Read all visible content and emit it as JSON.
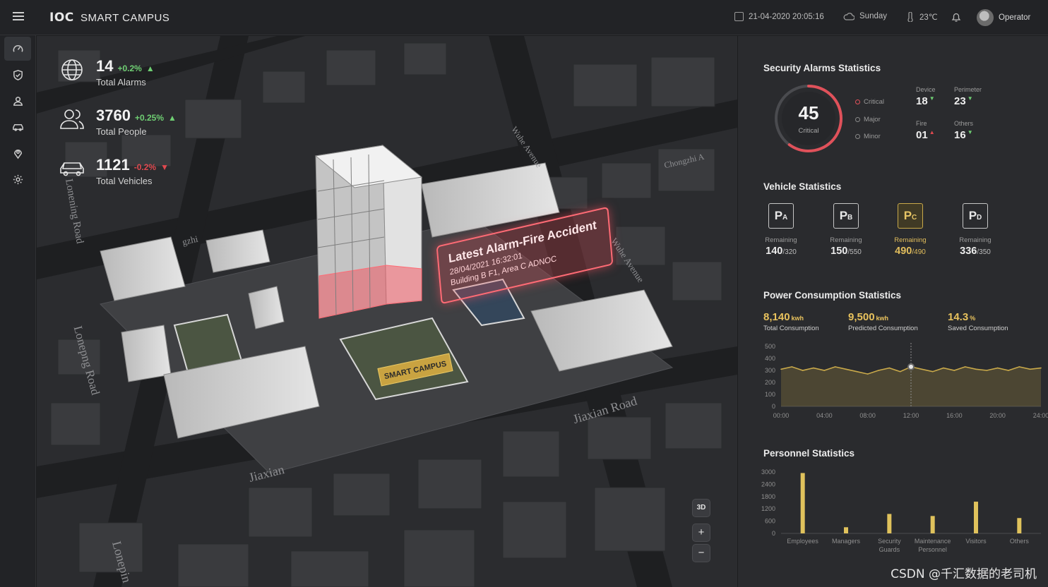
{
  "header": {
    "brand": "IOC",
    "app_name": "SMART CAMPUS",
    "datetime": "21-04-2020 20:05:16",
    "weather": "Sunday",
    "temperature": "23℃",
    "user": "Operator"
  },
  "nav": [
    {
      "icon": "dashboard-icon"
    },
    {
      "icon": "shield-icon"
    },
    {
      "icon": "people-icon"
    },
    {
      "icon": "car-icon"
    },
    {
      "icon": "map-pin-icon"
    },
    {
      "icon": "gear-icon"
    }
  ],
  "map": {
    "stats": [
      {
        "value": "14",
        "change": "+0.2%",
        "trend": "up",
        "label": "Total Alarms",
        "icon": "globe-icon"
      },
      {
        "value": "3760",
        "change": "+0.25%",
        "trend": "up",
        "label": "Total People",
        "icon": "people-icon"
      },
      {
        "value": "1121",
        "change": "-0.2%",
        "trend": "down",
        "label": "Total Vehicles",
        "icon": "car-icon"
      }
    ],
    "alarm": {
      "title": "Latest Alarm-Fire Accident",
      "time": "28/04/2021 16:32:01",
      "location": "Building B F1, Area C ADNOC"
    },
    "campus_sign": "SMART CAMPUS",
    "roads": [
      "Lonening Road",
      "Lonepng Road",
      "Lonepin",
      "Jiaxian Road",
      "Jiaxian",
      "Wuhe Avenue",
      "Wuhe Avenue",
      "Chongzhi A",
      "gzhi"
    ],
    "controls": {
      "view_3d": "3D",
      "zoom_in": "+",
      "zoom_out": "−"
    }
  },
  "security": {
    "title": "Security Alarms Statistics",
    "critical_count": "45",
    "critical_label": "Critical",
    "legend": [
      "Critical",
      "Major",
      "Minor"
    ],
    "items": [
      {
        "label": "Device",
        "value": "18",
        "trend": "down"
      },
      {
        "label": "Perimeter",
        "value": "23",
        "trend": "down"
      },
      {
        "label": "Fire",
        "value": "01",
        "trend": "up"
      },
      {
        "label": "Others",
        "value": "16",
        "trend": "down"
      }
    ],
    "ring_fraction": 0.6
  },
  "vehicles": {
    "title": "Vehicle Statistics",
    "lots": [
      {
        "letter": "P",
        "sub": "A",
        "label": "Remaining",
        "remaining": "140",
        "total": "/320",
        "highlight": false
      },
      {
        "letter": "P",
        "sub": "B",
        "label": "Remaining",
        "remaining": "150",
        "total": "/550",
        "highlight": false
      },
      {
        "letter": "P",
        "sub": "C",
        "label": "Remaining",
        "remaining": "490",
        "total": "/490",
        "highlight": true
      },
      {
        "letter": "P",
        "sub": "D",
        "label": "Remaining",
        "remaining": "336",
        "total": "/350",
        "highlight": false
      }
    ]
  },
  "power": {
    "title": "Power Consumption Statistics",
    "kpis": [
      {
        "value": "8,140",
        "unit": "kwh",
        "label": "Total Consumption"
      },
      {
        "value": "9,500",
        "unit": "kwh",
        "label": "Predicted Consumption"
      },
      {
        "value": "14.3",
        "unit": "%",
        "label": "Saved Consumption"
      }
    ]
  },
  "personnel": {
    "title": "Personnel Statistics"
  },
  "chart_data": [
    {
      "type": "area",
      "x": [
        "00:00",
        "01:00",
        "02:00",
        "03:00",
        "04:00",
        "05:00",
        "06:00",
        "07:00",
        "08:00",
        "09:00",
        "10:00",
        "11:00",
        "12:00",
        "13:00",
        "14:00",
        "15:00",
        "16:00",
        "17:00",
        "18:00",
        "19:00",
        "20:00",
        "21:00",
        "22:00",
        "23:00",
        "24:00"
      ],
      "values": [
        310,
        330,
        300,
        320,
        300,
        330,
        310,
        290,
        270,
        300,
        320,
        290,
        330,
        310,
        290,
        320,
        300,
        330,
        310,
        300,
        320,
        300,
        330,
        310,
        320
      ],
      "xticks": [
        "00:00",
        "04:00",
        "08:00",
        "12:00",
        "16:00",
        "20:00",
        "24:00"
      ],
      "yticks": [
        0,
        100,
        200,
        300,
        400,
        500
      ],
      "ylim": [
        0,
        500
      ],
      "color": "#c9a94a"
    },
    {
      "type": "bar",
      "categories": [
        "Employees",
        "Managers",
        "Security Guards",
        "Maintenance Personnel",
        "Visitors",
        "Others"
      ],
      "values": [
        2950,
        300,
        950,
        850,
        1550,
        750
      ],
      "yticks": [
        0,
        600,
        1200,
        1800,
        2400,
        3000
      ],
      "ylim": [
        0,
        3000
      ],
      "color": "#e0c25c"
    }
  ],
  "watermark": "CSDN @千汇数据的老司机"
}
